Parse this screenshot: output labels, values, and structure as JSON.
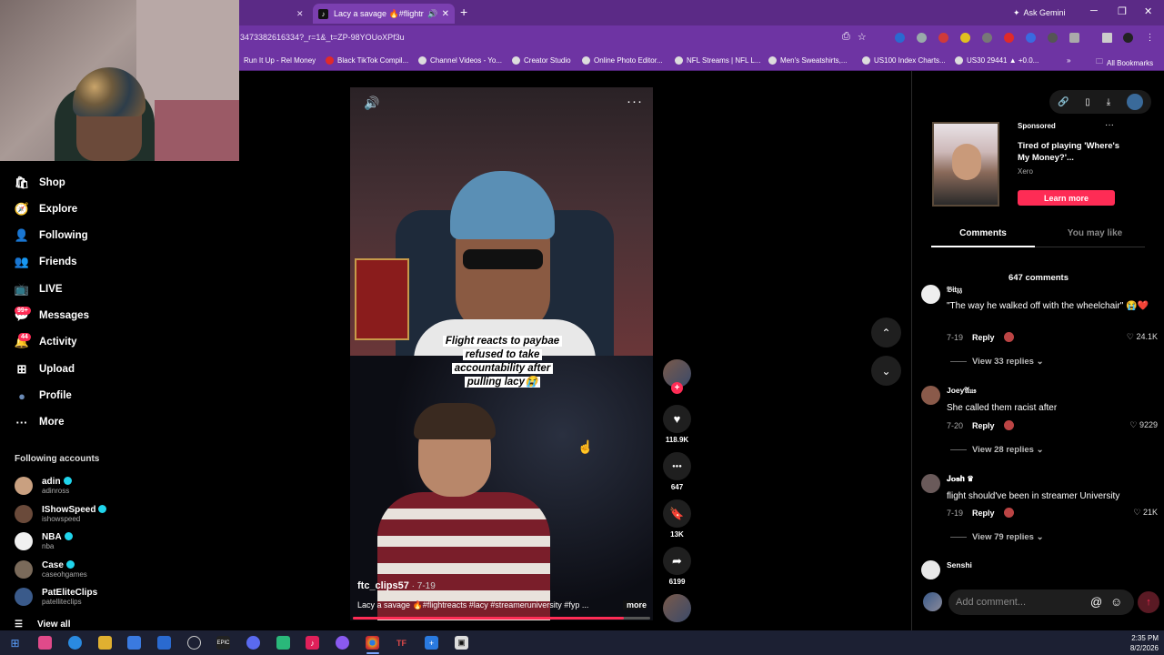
{
  "browser": {
    "active_tab_title": "Lacy a savage 🔥#flightreacts",
    "close_glyph": "✕",
    "new_tab_glyph": "+",
    "gemini_label": "Ask Gemini",
    "url": "3473382616334?_r=1&_t=ZP-98YOUoXPf3u",
    "bookmarks": [
      "Run It Up - Rel Money",
      "Black TikTok Compil...",
      "Channel Videos - Yo...",
      "Creator Studio",
      "Online Photo Editor...",
      "NFL Streams | NFL L...",
      "Men's Sweatshirts,...",
      "US100 Index Charts...",
      "US30 29441 ▲ +0.0..."
    ],
    "all_bookmarks": "All Bookmarks",
    "bookmark_overflow": "»"
  },
  "sidebar": {
    "nav": [
      {
        "label": "Shop",
        "icon": "🛍"
      },
      {
        "label": "Explore",
        "icon": "🧭"
      },
      {
        "label": "Following",
        "icon": "👤"
      },
      {
        "label": "Friends",
        "icon": "👥"
      },
      {
        "label": "LIVE",
        "icon": "📺"
      },
      {
        "label": "Messages",
        "icon": "💬"
      },
      {
        "label": "Activity",
        "icon": "🔔"
      },
      {
        "label": "Upload",
        "icon": "⊞"
      },
      {
        "label": "Profile",
        "icon": "●"
      },
      {
        "label": "More",
        "icon": "···"
      }
    ],
    "messages_badge": "99+",
    "activity_badge": "44",
    "following_heading": "Following accounts",
    "accounts": [
      {
        "name": "adin",
        "handle": "adinross",
        "color": "#c9a080"
      },
      {
        "name": "IShowSpeed",
        "handle": "ishowspeed",
        "color": "#6a4a3a"
      },
      {
        "name": "NBA",
        "handle": "nba",
        "color": "#f0f0f0"
      },
      {
        "name": "Case",
        "handle": "caseohgames",
        "color": "#7a6a5a"
      },
      {
        "name": "PatEliteClips",
        "handle": "patelliteclips",
        "color": "#3a5a8a"
      }
    ],
    "view_all": "View all"
  },
  "video": {
    "caption_lines": [
      "Flight reacts to paybae",
      "refused to take",
      "accountability after",
      "pulling lacy😭"
    ],
    "author": "ftc_clips57",
    "date": " · 7-19",
    "description": "Lacy a savage 🔥#flightreacts #lacy #streameruniversity #fyp ...",
    "more_label": "more",
    "progress": 0.91,
    "volume_icon": "🔊",
    "more_icon": "···"
  },
  "actions": {
    "follow_plus": "+",
    "like_icon": "♥",
    "like_count": "118.9K",
    "comment_icon": "●●●",
    "comment_count": "647",
    "save_icon": "🔖",
    "save_count": "13K",
    "share_icon": "➦",
    "share_count": "6199",
    "up_arrow": "⌃",
    "down_arrow": "⌄"
  },
  "panel": {
    "top_icons": [
      "🔗",
      "▯",
      "⤓"
    ],
    "sponsored": "Sponsored",
    "ad_more": "···",
    "ad_title": "Tired of playing 'Where's My Money?'...",
    "ad_brand": "Xero",
    "learn_more": "Learn more",
    "tab_comments": "Comments",
    "tab_you_may_like": "You may like",
    "comment_count": "647 comments",
    "comments": [
      {
        "user": "𝔅𝔦𝔱𝔷𝔷",
        "text": "\"The way he walked off with the wheelchair\" 😭❤️",
        "date": "7-19",
        "reply": "Reply",
        "likes": "♡ 24.1K",
        "view_replies": "View 33 replies ⌄"
      },
      {
        "user": "Joey𝔄𝔲𝔰",
        "text": "She called them racist after",
        "date": "7-20",
        "reply": "Reply",
        "likes": "♡ 9229",
        "view_replies": "View 28 replies ⌄"
      },
      {
        "user": "𝐉𝐨𝐬𝐡 ♛",
        "text": "flight should've been in streamer University",
        "date": "7-19",
        "reply": "Reply",
        "likes": "♡ 21K",
        "view_replies": "View 79 replies ⌄"
      },
      {
        "user": "Senshi",
        "text": "",
        "date": "",
        "reply": "",
        "likes": "",
        "view_replies": ""
      }
    ],
    "add_comment_placeholder": "Add comment...",
    "at_icon": "@",
    "emoji_icon": "☺",
    "post_icon": "↑"
  },
  "taskbar": {
    "time": "2:35 PM",
    "date": "8/2/2026"
  }
}
